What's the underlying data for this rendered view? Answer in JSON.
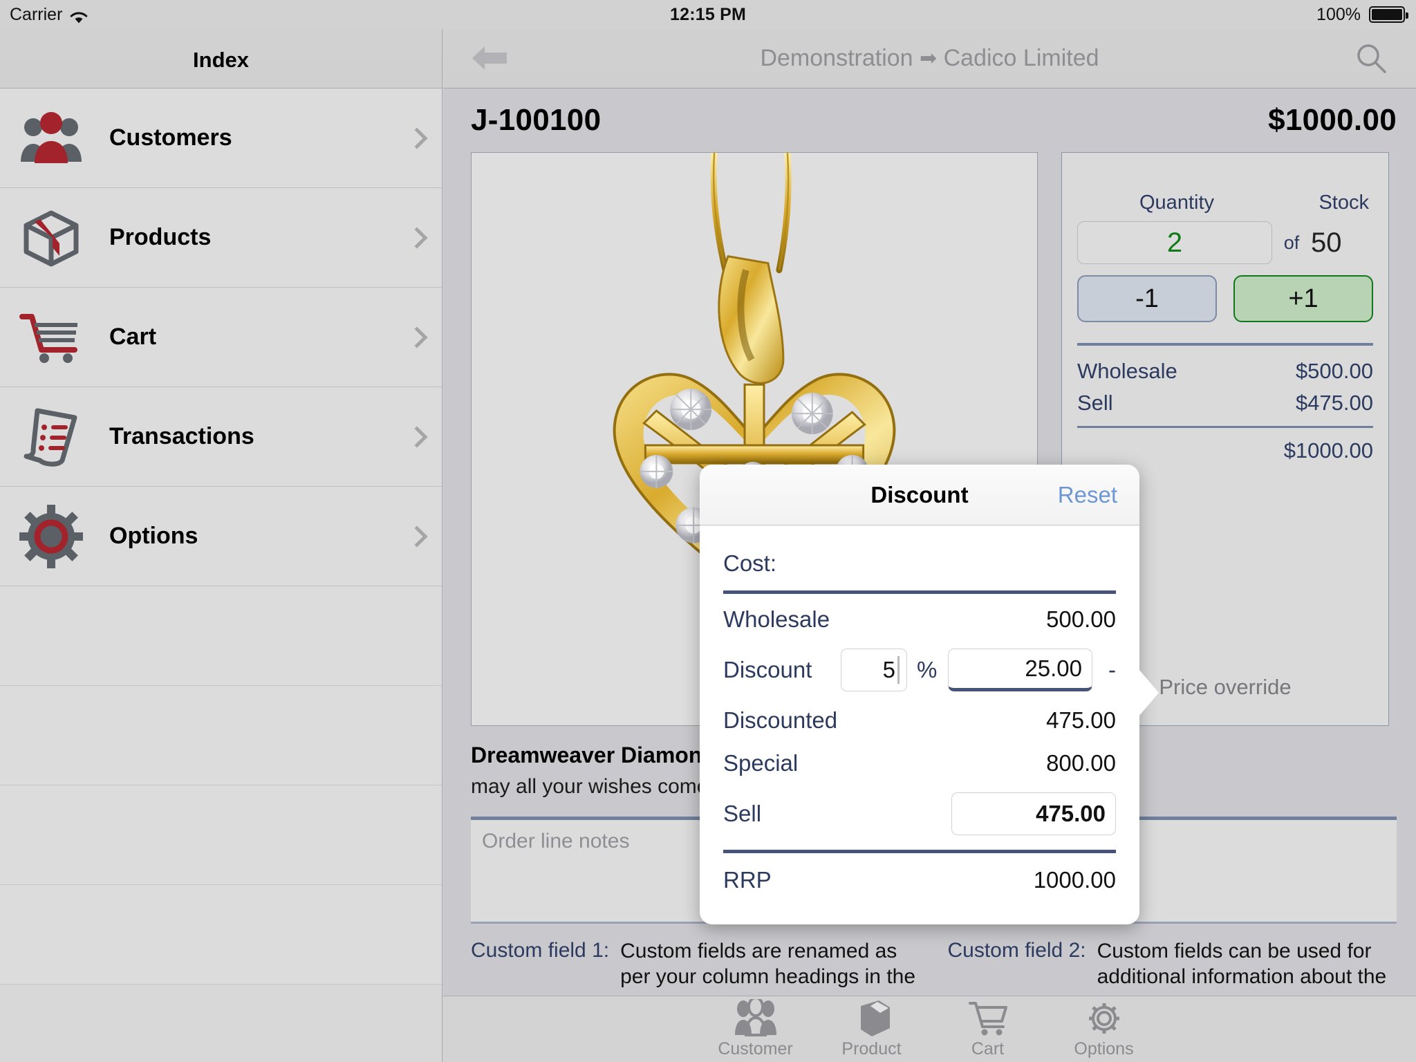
{
  "status_bar": {
    "carrier": "Carrier",
    "wifi_icon": "wifi-icon",
    "time": "12:15 PM",
    "battery_percent": "100%",
    "battery_icon": "battery-full-icon"
  },
  "sidebar": {
    "title": "Index",
    "items": [
      {
        "label": "Customers",
        "icon": "customers-icon",
        "chevron": "chevron-right-icon"
      },
      {
        "label": "Products",
        "icon": "products-box-icon",
        "chevron": "chevron-right-icon"
      },
      {
        "label": "Cart",
        "icon": "cart-icon",
        "chevron": "chevron-right-icon"
      },
      {
        "label": "Transactions",
        "icon": "transactions-icon",
        "chevron": "chevron-right-icon"
      },
      {
        "label": "Options",
        "icon": "gear-icon",
        "chevron": "chevron-right-icon"
      }
    ]
  },
  "navbar": {
    "back_icon": "back-arrow-icon",
    "title_left": "Demonstration",
    "title_arrow": "➡",
    "title_right": "Cadico Limited",
    "search_icon": "search-icon"
  },
  "product": {
    "code": "J-100100",
    "price": "$1000.00",
    "image_alt": "gold-diamond-heart-pendant-photo",
    "name": "Dreamweaver Diamond Heart Pendant",
    "description": "may all your wishes come true with this dreamy diamond heart pendant",
    "notes_placeholder": "Order line notes"
  },
  "quantity_panel": {
    "quantity_label": "Quantity",
    "stock_label": "Stock",
    "quantity_value": "2",
    "of_label": "of",
    "stock_value": "50",
    "decrement_label": "-1",
    "increment_label": "+1",
    "price_rows": [
      {
        "label": "Wholesale",
        "value": "$500.00"
      },
      {
        "label": "Sell",
        "value": "$475.00"
      }
    ],
    "total_value": "$1000.00",
    "override_label": "Price override"
  },
  "discount_popover": {
    "title": "Discount",
    "reset_label": "Reset",
    "cost_label": "Cost:",
    "wholesale_label": "Wholesale",
    "wholesale_value": "500.00",
    "discount_label": "Discount",
    "discount_percent": "5",
    "percent_sign": "%",
    "discount_amount": "25.00",
    "minus_sign": "-",
    "discounted_label": "Discounted",
    "discounted_value": "475.00",
    "special_label": "Special",
    "special_value": "800.00",
    "sell_label": "Sell",
    "sell_value": "475.00",
    "rrp_label": "RRP",
    "rrp_value": "1000.00"
  },
  "custom_fields": [
    {
      "label": "Custom field 1:",
      "value": "Custom fields are renamed as per your column headings in the"
    },
    {
      "label": "Custom field 2:",
      "value": "Custom fields can be used for additional information about the"
    }
  ],
  "tabbar": {
    "tabs": [
      {
        "label": "Customer",
        "icon": "customer-tab-icon"
      },
      {
        "label": "Product",
        "icon": "product-tab-icon"
      },
      {
        "label": "Cart",
        "icon": "cart-tab-icon"
      },
      {
        "label": "Options",
        "icon": "options-gear-tab-icon"
      }
    ]
  },
  "colors": {
    "accent_blue": "#2b3a5e",
    "link_blue": "#6d97d4",
    "positive_green": "#12771c",
    "brand_red": "#a2232c",
    "chrome_gray": "#d2d2d2"
  }
}
